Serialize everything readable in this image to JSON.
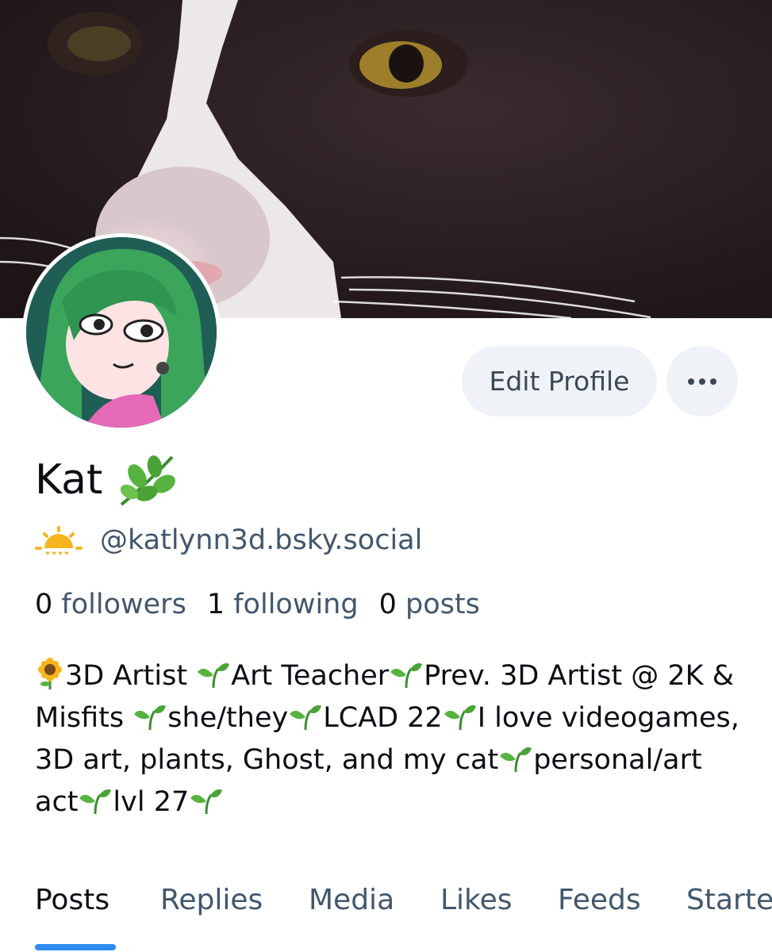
{
  "profile": {
    "display_name": "Kat",
    "name_emoji": "herb-icon",
    "handle_emoji": "sunrise-icon",
    "handle": "@katlynn3d.bsky.social",
    "stats": [
      {
        "count": "0",
        "label": "followers"
      },
      {
        "count": "1",
        "label": "following"
      },
      {
        "count": "0",
        "label": "posts"
      }
    ],
    "bio_segments": [
      "3D Artist ",
      "Art Teacher",
      "Prev. 3D Artist @ 2K & Misfits ",
      "she/they",
      "LCAD 22",
      "I love videogames, 3D art, plants, Ghost, and my cat",
      "personal/art act",
      "lvl 27"
    ]
  },
  "actions": {
    "edit_label": "Edit Profile",
    "more_label": "•••"
  },
  "tabs": [
    {
      "label": "Posts",
      "active": true
    },
    {
      "label": "Replies",
      "active": false
    },
    {
      "label": "Media",
      "active": false
    },
    {
      "label": "Likes",
      "active": false
    },
    {
      "label": "Feeds",
      "active": false
    },
    {
      "label": "Starte",
      "active": false
    }
  ],
  "colors": {
    "accent": "#2f8cf2",
    "muted_text": "#42576c",
    "button_bg": "#eff2f6"
  }
}
